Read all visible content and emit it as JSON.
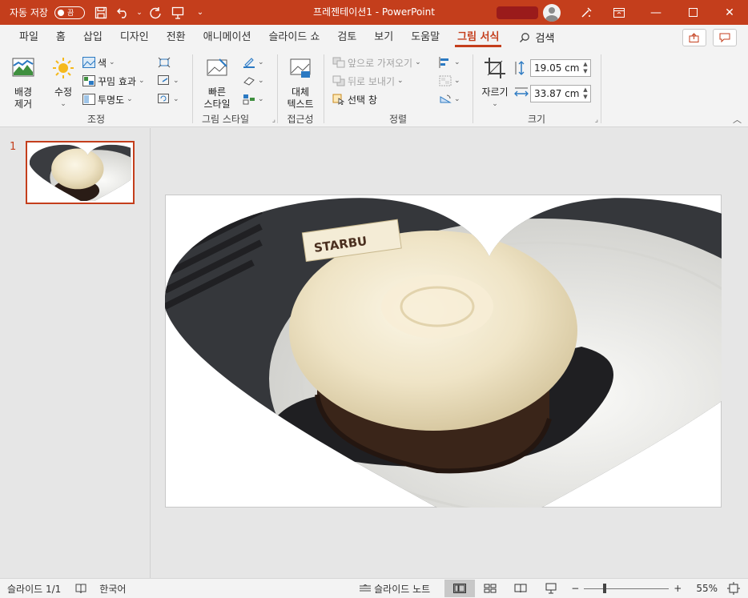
{
  "titlebar": {
    "autosave_label": "자동 저장",
    "autosave_state": "끔",
    "title": "프레젠테이션1  -  PowerPoint"
  },
  "tabs": [
    {
      "label": "파일"
    },
    {
      "label": "홈"
    },
    {
      "label": "삽입"
    },
    {
      "label": "디자인"
    },
    {
      "label": "전환"
    },
    {
      "label": "애니메이션"
    },
    {
      "label": "슬라이드 쇼"
    },
    {
      "label": "검토"
    },
    {
      "label": "보기"
    },
    {
      "label": "도움말"
    },
    {
      "label": "그림 서식"
    }
  ],
  "active_tab": "그림 서식",
  "search_label": "검색",
  "ribbon": {
    "adjust": {
      "label": "조정",
      "remove_bg": "배경\n제거",
      "corrections": "수정",
      "color": "색",
      "artistic": "꾸밈 효과",
      "transparency": "투명도"
    },
    "styles": {
      "label": "그림 스타일",
      "quick_styles": "빠른\n스타일"
    },
    "accessibility": {
      "label": "접근성",
      "alt_text": "대체\n텍스트"
    },
    "arrange": {
      "label": "정렬",
      "bring_forward": "앞으로 가져오기",
      "send_backward": "뒤로 보내기",
      "selection_pane": "선택 창"
    },
    "size": {
      "label": "크기",
      "crop": "자르기",
      "height": "19.05 cm",
      "width": "33.87 cm"
    }
  },
  "thumbnails": [
    {
      "number": "1"
    }
  ],
  "status": {
    "slide_info": "슬라이드 1/1",
    "language": "한국어",
    "notes": "슬라이드 노트",
    "zoom_minus": "−",
    "zoom_plus": "+",
    "zoom": "55%"
  },
  "colors": {
    "accent": "#c43e1c",
    "ribbon_bg": "#f3f3f3",
    "canvas_bg": "#e6e6e6"
  }
}
